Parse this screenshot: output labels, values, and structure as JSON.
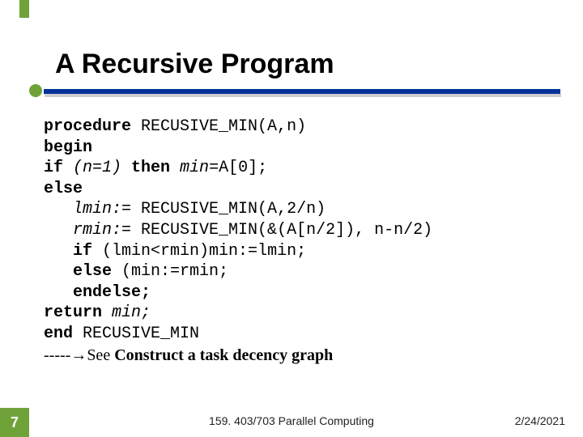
{
  "title": "A Recursive Program",
  "code": {
    "l1a": "procedure",
    "l1b": " RECUSIVE_MIN(A,n)",
    "l2": "begin",
    "l3a": "if ",
    "l3b": "(n=1) ",
    "l3c": "then ",
    "l3d": "min",
    "l3e": "=A[0];",
    "l4": "else",
    "l5a": "   ",
    "l5b": "lmin:",
    "l5c": "= RECUSIVE_MIN(A,2/n)",
    "l6a": "   ",
    "l6b": "rmin:",
    "l6c": "= RECUSIVE_MIN(&(A[n/2]), n-n/2)",
    "l7a": "   ",
    "l7b": "if ",
    "l7c": "(lmin<rmin)min:=lmin;",
    "l8a": "   ",
    "l8b": "else ",
    "l8c": "(min:=rmin;",
    "l9a": "   ",
    "l9b": "endelse;",
    "l10a": "return ",
    "l10b": "min;",
    "l11a": "end ",
    "l11b": "RECUSIVE_MIN"
  },
  "note": {
    "dashes": "-----",
    "arrow": "→",
    "text1": "See ",
    "text2": "Construct a task decency graph"
  },
  "page": "7",
  "footer_center": "159. 403/703 Parallel Computing",
  "footer_right": "2/24/2021"
}
